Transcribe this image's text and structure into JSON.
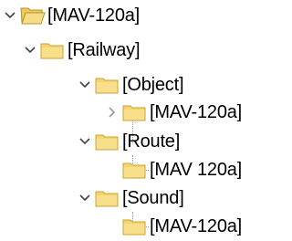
{
  "tree": {
    "root": {
      "label": "[MAV-120a]",
      "icon": "folder-open-icon",
      "expanded": true
    },
    "railway": {
      "label": "[Railway]",
      "icon": "folder-icon",
      "expanded": true
    },
    "object": {
      "label": "[Object]",
      "icon": "folder-icon",
      "expanded": true
    },
    "object_child": {
      "label": "[MAV-120a]",
      "icon": "folder-icon",
      "expanded": false
    },
    "route": {
      "label": "[Route]",
      "icon": "folder-icon",
      "expanded": true
    },
    "route_child": {
      "label": "[MAV 120a]",
      "icon": "folder-icon"
    },
    "sound": {
      "label": "[Sound]",
      "icon": "folder-icon",
      "expanded": true
    },
    "sound_child": {
      "label": "[MAV-120a]",
      "icon": "folder-icon"
    }
  },
  "colors": {
    "folder_fill": "#f5d46e",
    "folder_edge": "#c8a336",
    "chevron": "#444444",
    "chevron_collapsed": "#9a9a9a"
  }
}
